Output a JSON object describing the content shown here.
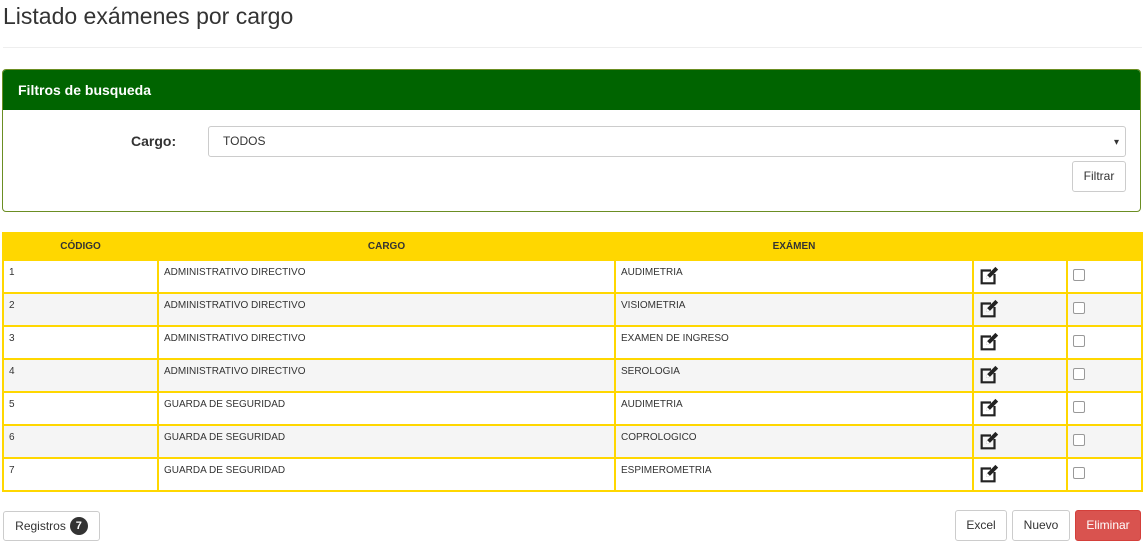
{
  "page": {
    "title": "Listado exámenes por cargo"
  },
  "filters": {
    "heading": "Filtros de busqueda",
    "cargo_label": "Cargo:",
    "cargo_value": "TODOS",
    "filter_button": "Filtrar"
  },
  "table": {
    "headers": [
      "CÓDIGO",
      "CARGO",
      "EXÁMEN",
      "",
      ""
    ],
    "rows": [
      {
        "codigo": "1",
        "cargo": "ADMINISTRATIVO DIRECTIVO",
        "examen": "AUDIMETRIA"
      },
      {
        "codigo": "2",
        "cargo": "ADMINISTRATIVO DIRECTIVO",
        "examen": "VISIOMETRIA"
      },
      {
        "codigo": "3",
        "cargo": "ADMINISTRATIVO DIRECTIVO",
        "examen": "EXAMEN DE INGRESO"
      },
      {
        "codigo": "4",
        "cargo": "ADMINISTRATIVO DIRECTIVO",
        "examen": "SEROLOGIA"
      },
      {
        "codigo": "5",
        "cargo": "GUARDA DE SEGURIDAD",
        "examen": "AUDIMETRIA"
      },
      {
        "codigo": "6",
        "cargo": "GUARDA DE SEGURIDAD",
        "examen": "COPROLOGICO"
      },
      {
        "codigo": "7",
        "cargo": "GUARDA DE SEGURIDAD",
        "examen": "ESPIMEROMETRIA"
      }
    ],
    "row_icon": "edit-icon"
  },
  "footer": {
    "registros_label": "Registros",
    "registros_count": "7",
    "excel_label": "Excel",
    "nuevo_label": "Nuevo",
    "eliminar_label": "Eliminar"
  },
  "colors": {
    "panel_header": "#006400",
    "table_header": "#ffd700",
    "danger": "#d9534f"
  }
}
